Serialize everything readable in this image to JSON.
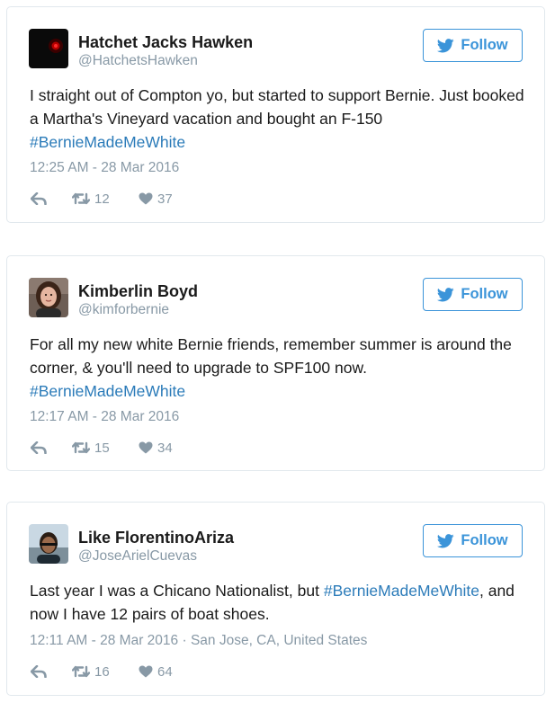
{
  "tweets": [
    {
      "name": "Hatchet Jacks Hawken",
      "handle": "@HatchetsHawken",
      "follow_label": "Follow",
      "text_parts": [
        {
          "kind": "text",
          "value": "I straight out of Compton yo, but started to support Bernie. Just booked a Martha's Vineyard vacation and bought an F-150 "
        },
        {
          "kind": "hashtag",
          "value": "#BernieMadeMeWhite"
        }
      ],
      "timestamp": "12:25 AM - 28 Mar 2016",
      "location": "",
      "retweets": "12",
      "likes": "37",
      "avatar_icon": "avatar-dark-red-dot"
    },
    {
      "name": "Kimberlin Boyd",
      "handle": "@kimforbernie",
      "follow_label": "Follow",
      "text_parts": [
        {
          "kind": "text",
          "value": "For all my new white Bernie friends, remember summer is around the corner, & you'll need to upgrade to SPF100 now. "
        },
        {
          "kind": "hashtag",
          "value": "#BernieMadeMeWhite"
        }
      ],
      "timestamp": "12:17 AM - 28 Mar 2016",
      "location": "",
      "retweets": "15",
      "likes": "34",
      "avatar_icon": "avatar-portrait-woman"
    },
    {
      "name": "Like FlorentinoAriza",
      "handle": "@JoseArielCuevas",
      "follow_label": "Follow",
      "text_parts": [
        {
          "kind": "text",
          "value": "Last year I was a Chicano Nationalist, but "
        },
        {
          "kind": "hashtag",
          "value": "#BernieMadeMeWhite"
        },
        {
          "kind": "text",
          "value": ", and now I have 12 pairs of boat shoes."
        }
      ],
      "timestamp": "12:11 AM - 28 Mar 2016",
      "location": "San Jose, CA, United States",
      "retweets": "16",
      "likes": "64",
      "avatar_icon": "avatar-portrait-man"
    }
  ],
  "meta_separator": " · ",
  "colors": {
    "link_blue": "#2b7bb9",
    "follow_blue": "#3b94d9",
    "muted_gray": "#8899a6",
    "border": "#e1e8ed"
  },
  "icons": {
    "follow": "twitter-bird-icon",
    "reply": "reply-icon",
    "retweet": "retweet-icon",
    "like": "heart-icon"
  }
}
